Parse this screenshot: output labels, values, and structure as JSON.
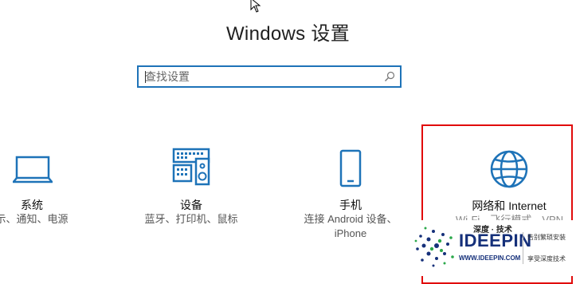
{
  "page": {
    "title": "Windows 设置"
  },
  "search": {
    "placeholder": "查找设置"
  },
  "tiles": [
    {
      "name": "系统",
      "desc": "示、通知、电源"
    },
    {
      "name": "设备",
      "desc": "蓝牙、打印机、鼠标"
    },
    {
      "name": "手机",
      "desc_line1": "连接 Android 设备、",
      "desc_line2": "iPhone"
    },
    {
      "name": "网络和 Internet",
      "desc": "Wi-Fi、飞行模式、VPN"
    }
  ],
  "watermark": {
    "title": "深度 · 技术",
    "brand": "IDEEPIN",
    "url": "WWW.IDEEPIN.COM",
    "side1": "告别繁琐安装",
    "side2": "享受深度技术"
  },
  "colors": {
    "accent": "#1e73b8",
    "highlight": "#e10b0b",
    "brand": "#15307a"
  }
}
